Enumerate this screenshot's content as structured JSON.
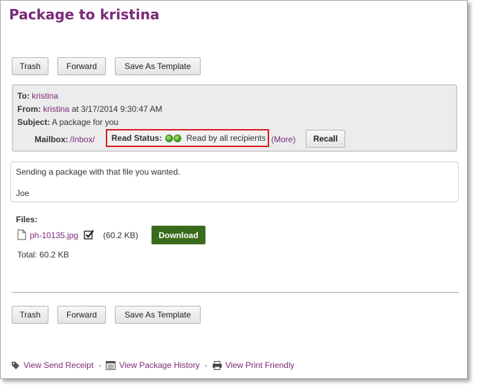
{
  "title": "Package to kristina",
  "toolbar": {
    "trash": "Trash",
    "forward": "Forward",
    "save_template": "Save As Template"
  },
  "header": {
    "to_label": "To:",
    "to_value": "kristina",
    "from_label": "From:",
    "from_user": "kristina",
    "from_rest": "at 3/17/2014 9:30:47 AM",
    "subject_label": "Subject:",
    "subject_value": "A package for you",
    "mailbox_label": "Mailbox:",
    "mailbox_value": "/Inbox/",
    "read_status_label": "Read Status:",
    "read_status_value": "Read by all recipients",
    "more": "(More)",
    "recall": "Recall"
  },
  "message": {
    "line1": "Sending a package with that file you wanted.",
    "line2": "Joe"
  },
  "files": {
    "label": "Files:",
    "items": [
      {
        "name": "ph-10135.jpg",
        "size": "(60.2 KB)"
      }
    ],
    "download": "Download",
    "total": "Total: 60.2 KB"
  },
  "footer": {
    "send_receipt": "View Send Receipt",
    "package_history": "View Package History",
    "print_friendly": "View Print Friendly",
    "separator": "-"
  },
  "colors": {
    "title": "#7a2a7a",
    "link": "#7a2a7a",
    "highlight": "#d81818",
    "download_bg": "#3a6a1c"
  },
  "icons": [
    "green-dots-icon",
    "file-icon",
    "checkbox-check-icon",
    "tag-icon",
    "list-icon",
    "printer-icon"
  ]
}
